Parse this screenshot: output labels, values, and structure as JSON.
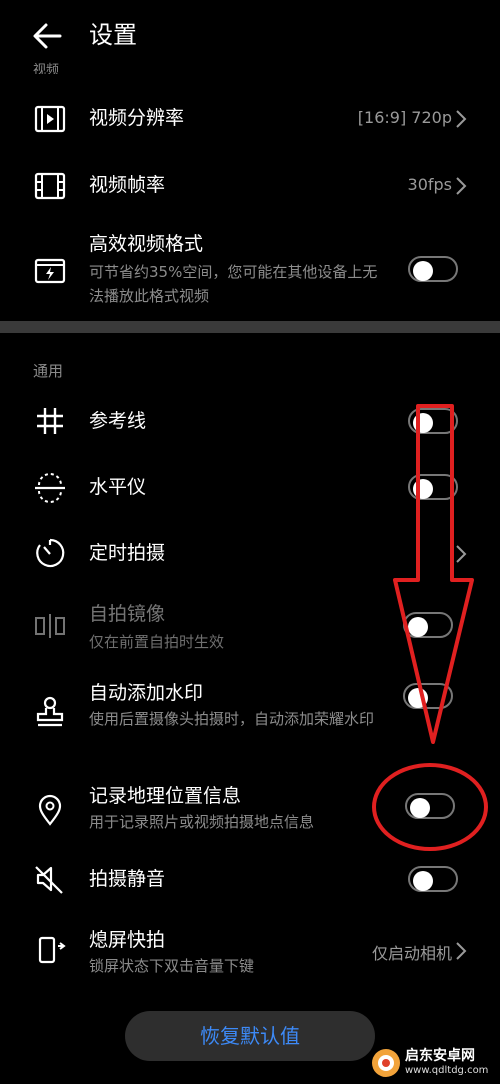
{
  "header": {
    "title": "设置"
  },
  "video_section_label": "视频",
  "rows": {
    "resolution": {
      "label": "视频分辨率",
      "value": "[16:9] 720p"
    },
    "framerate": {
      "label": "视频帧率",
      "value": "30fps"
    },
    "hevc": {
      "label": "高效视频格式",
      "desc": "可节省约35%空间，您可能在其他设备上无法播放此格式视频",
      "on": false
    },
    "gridlines": {
      "label": "参考线",
      "on": false
    },
    "level": {
      "label": "水平仪",
      "on": false
    },
    "timer": {
      "label": "定时拍摄"
    },
    "mirror": {
      "label": "自拍镜像",
      "desc": "仅在前置自拍时生效",
      "on": false
    },
    "watermark": {
      "label": "自动添加水印",
      "desc": "使用后置摄像头拍摄时，自动添加荣耀水印",
      "on": false
    },
    "location": {
      "label": "记录地理位置信息",
      "desc": "用于记录照片或视频拍摄地点信息",
      "on": false
    },
    "mute": {
      "label": "拍摄静音",
      "on": false
    },
    "quicksnap": {
      "label": "熄屏快拍",
      "desc": "锁屏状态下双击音量下键",
      "value": "仅启动相机"
    }
  },
  "general_section_label": "通用",
  "reset_button": "恢复默认值",
  "annotation_colors": {
    "arrow": "#e02020",
    "circle": "#e02020"
  },
  "watermark": {
    "name": "启东安卓网",
    "url": "www.qdltdg.com"
  }
}
